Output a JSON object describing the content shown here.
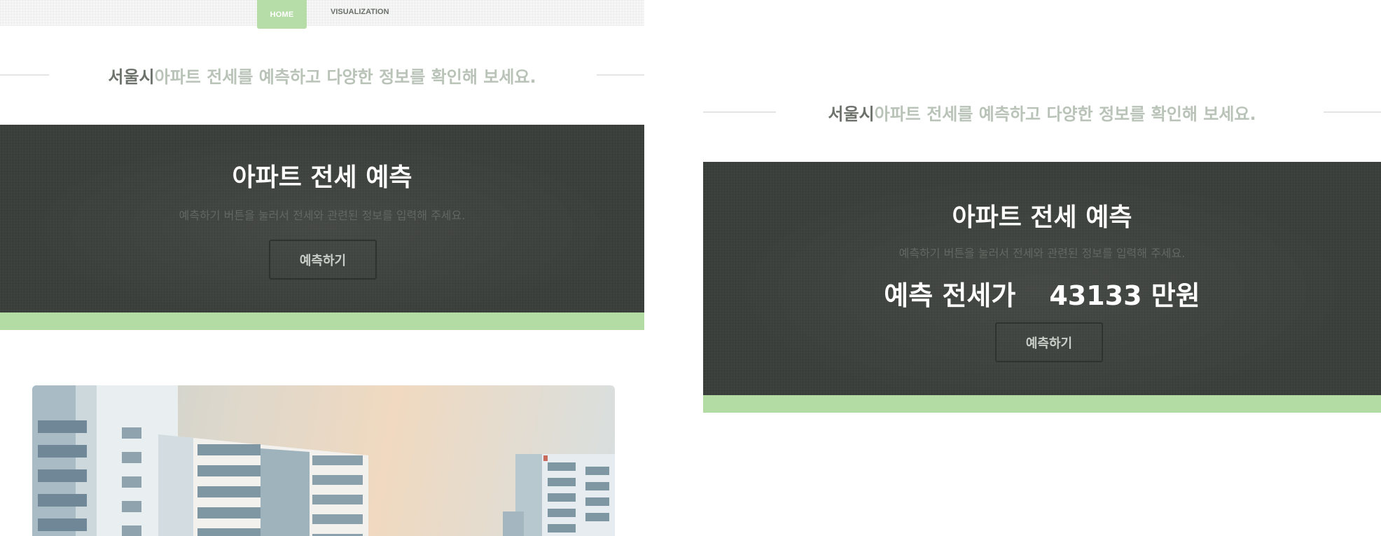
{
  "nav": {
    "home_label": "HOME",
    "visualization_label": "VISUALIZATION"
  },
  "headline": {
    "city": "서울시",
    "rest": " 아파트 전세를 예측하고 다양한 정보를 확인해 보세요."
  },
  "prediction": {
    "title": "아파트 전세 예측",
    "subtitle": "예측하기 버튼을 눌러서 전세와 관련된 정보를 입력해 주세요.",
    "button_label": "예측하기",
    "result_label": "예측 전세가",
    "result_value": "43133 만원"
  },
  "colors": {
    "accent_green": "#b3dca4",
    "band_dark": "#3a3e3a",
    "heading_gray": "#6d736c",
    "heading_light": "#b9c3b8"
  },
  "icons": {
    "hero_image": "apartment-building-image"
  }
}
